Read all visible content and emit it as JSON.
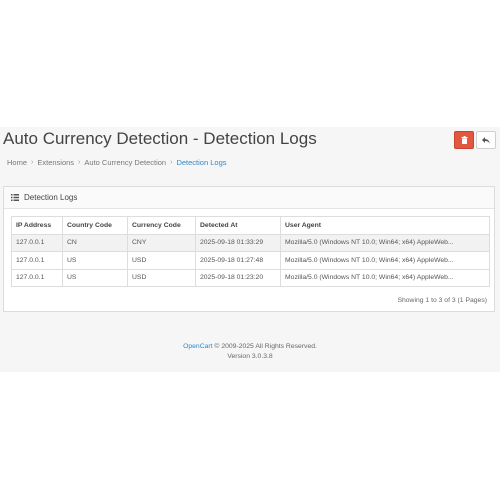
{
  "header": {
    "title": "Auto Currency Detection - Detection Logs",
    "delete_icon": "trash-icon",
    "back_icon": "reply-icon",
    "colors": {
      "delete": "#e2573f",
      "link": "#2d8ac7"
    }
  },
  "breadcrumb": {
    "items": [
      "Home",
      "Extensions",
      "Auto Currency Detection",
      "Detection Logs"
    ]
  },
  "panel": {
    "title": "Detection Logs",
    "icon": "list-icon"
  },
  "table": {
    "headers": [
      "IP Address",
      "Country Code",
      "Currency Code",
      "Detected At",
      "User Agent"
    ],
    "rows": [
      [
        "127.0.0.1",
        "CN",
        "CNY",
        "2025-09-18 01:33:29",
        "Mozilla/5.0 (Windows NT 10.0; Win64; x64) AppleWeb..."
      ],
      [
        "127.0.0.1",
        "US",
        "USD",
        "2025-09-18 01:27:48",
        "Mozilla/5.0 (Windows NT 10.0; Win64; x64) AppleWeb..."
      ],
      [
        "127.0.0.1",
        "US",
        "USD",
        "2025-09-18 01:23:20",
        "Mozilla/5.0 (Windows NT 10.0; Win64; x64) AppleWeb..."
      ]
    ]
  },
  "pagination": {
    "text": "Showing 1 to 3 of 3 (1 Pages)"
  },
  "footer": {
    "brand": "OpenCart",
    "copyright": "© 2009-2025 All Rights Reserved.",
    "version": "Version 3.0.3.8"
  }
}
